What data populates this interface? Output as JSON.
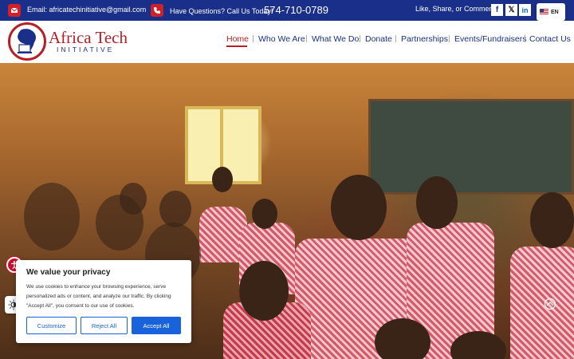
{
  "topbar": {
    "email": "Email: africatechinitiative@gmail.com",
    "phone_label": "Have Questions? Call Us Today!",
    "phone_number": "574-710-0789",
    "social_label": "Like, Share, or Comment:",
    "social": [
      {
        "name": "facebook",
        "glyph": "f"
      },
      {
        "name": "x",
        "glyph": "𝕏"
      },
      {
        "name": "linkedin",
        "glyph": "in"
      }
    ],
    "language": "EN"
  },
  "header": {
    "logo_line1": "Africa Tech",
    "logo_line2": "INITIATIVE",
    "nav": [
      "Home",
      "Who We Are",
      "What We Do",
      "Donate",
      "Partnerships",
      "Events/Fundraisers",
      "Contact Us"
    ],
    "active_nav": "Home"
  },
  "cookie": {
    "title": "We value your privacy",
    "text": "We use cookies to enhance your browsing experience, serve personalized ads or content, and analyze our traffic. By clicking \"Accept All\", you consent to our use of cookies.",
    "customize": "Customize",
    "reject": "Reject All",
    "accept": "Accept All"
  },
  "colors": {
    "brand_blue": "#1a2f8a",
    "brand_red": "#b51f26",
    "cookie_blue": "#1863dc"
  }
}
